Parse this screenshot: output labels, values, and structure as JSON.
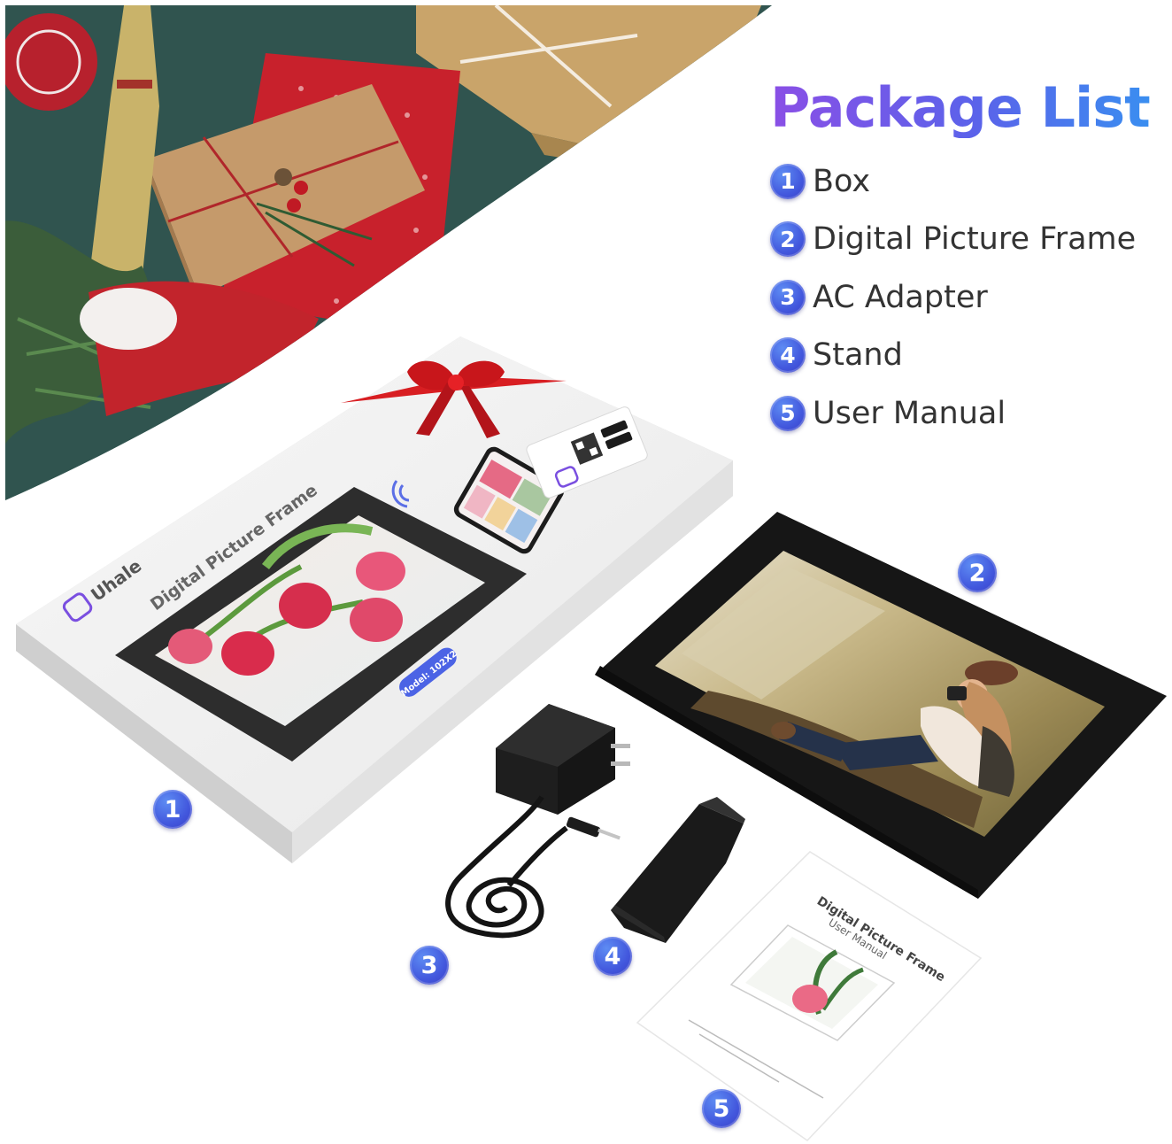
{
  "heading": "Package List",
  "items": [
    {
      "number": "1",
      "label": "Box"
    },
    {
      "number": "2",
      "label": "Digital Picture Frame"
    },
    {
      "number": "3",
      "label": "AC Adapter"
    },
    {
      "number": "4",
      "label": "Stand"
    },
    {
      "number": "5",
      "label": "User Manual"
    }
  ],
  "box": {
    "brand": "Uhale",
    "title": "Digital Picture Frame",
    "model": "Model: 102X2"
  },
  "manual": {
    "title": "Digital Picture Frame",
    "subtitle": "User Manual"
  },
  "colors": {
    "heading_start": "#8a4fe6",
    "heading_end": "#3a8ef0",
    "badge": "#4257dd",
    "ribbon": "#d81e22"
  }
}
